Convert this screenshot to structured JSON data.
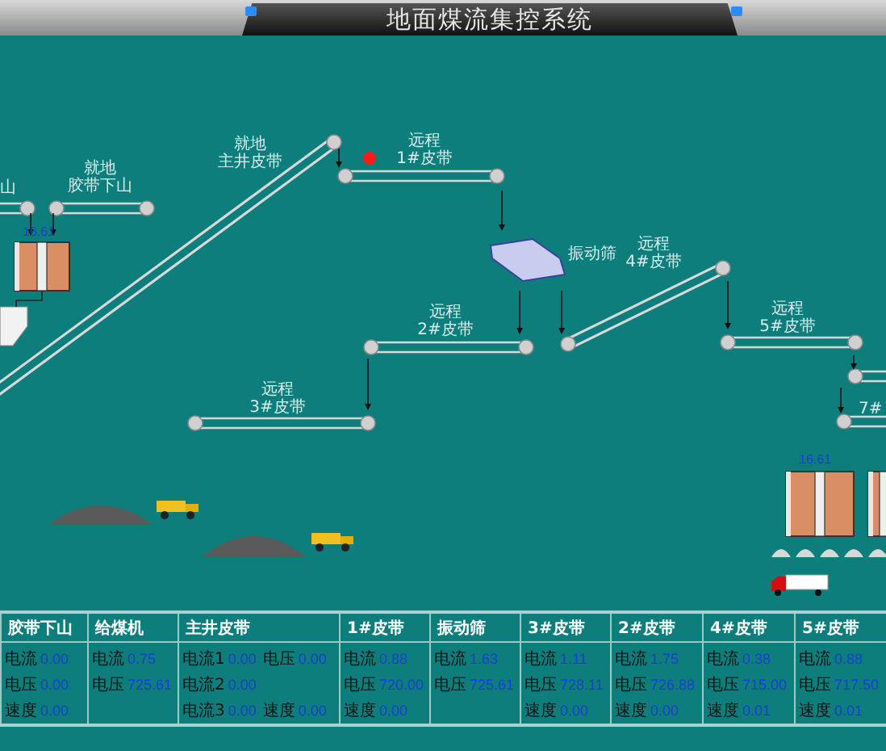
{
  "window": {
    "title": "地面煤流集控系统"
  },
  "diagram": {
    "belts": [
      {
        "kind": "flat",
        "name": "山"
      },
      {
        "kind": "flat",
        "mode": "就地",
        "name": "胶带下山"
      },
      {
        "kind": "incline",
        "mode": "就地",
        "name": "主井皮带"
      },
      {
        "kind": "flat",
        "mode": "远程",
        "name": "1#皮带"
      },
      {
        "kind": "flat",
        "mode": "远程",
        "name": "2#皮带"
      },
      {
        "kind": "flat",
        "mode": "远程",
        "name": "3#皮带"
      },
      {
        "kind": "incline",
        "mode": "远程",
        "name": "4#皮带"
      },
      {
        "kind": "flat",
        "mode": "远程",
        "name": "5#皮带"
      },
      {
        "kind": "flat"
      },
      {
        "kind": "flat",
        "name": "7#"
      }
    ],
    "screen": {
      "name": "振动筛"
    },
    "silos": [
      {
        "reading": "16.61"
      },
      {
        "reading": "16.61"
      }
    ]
  },
  "table": {
    "columns": [
      {
        "kind": "normal",
        "header": "胶带下山",
        "fields": [
          {
            "label": "电流",
            "value": "0.00"
          },
          {
            "label": "电压",
            "value": "0.00"
          },
          {
            "label": "速度",
            "value": "0.00"
          }
        ]
      },
      {
        "kind": "normal",
        "header": "给煤机",
        "fields": [
          {
            "label": "电流",
            "value": "0.75"
          },
          {
            "label": "电压",
            "value": "725.61"
          }
        ]
      },
      {
        "kind": "wide",
        "header": "主井皮带",
        "fields": [
          {
            "label": "电流1",
            "value": "0.00"
          },
          {
            "label": "电压",
            "value": "0.00"
          },
          {
            "label": "电流2",
            "value": "0.00"
          },
          {
            "label": "电流3",
            "value": "0.00"
          },
          {
            "label": "速度",
            "value": "0.00"
          }
        ]
      },
      {
        "kind": "normal",
        "header": "1#皮带",
        "fields": [
          {
            "label": "电流",
            "value": "0.88"
          },
          {
            "label": "电压",
            "value": "720.00"
          },
          {
            "label": "速度",
            "value": "0.00"
          }
        ]
      },
      {
        "kind": "normal",
        "header": "振动筛",
        "fields": [
          {
            "label": "电流",
            "value": "1.63"
          },
          {
            "label": "电压",
            "value": "725.61"
          }
        ]
      },
      {
        "kind": "normal",
        "header": "3#皮带",
        "fields": [
          {
            "label": "电流",
            "value": "1.11"
          },
          {
            "label": "电压",
            "value": "728.11"
          },
          {
            "label": "速度",
            "value": "0.00"
          }
        ]
      },
      {
        "kind": "normal",
        "header": "2#皮带",
        "fields": [
          {
            "label": "电流",
            "value": "1.75"
          },
          {
            "label": "电压",
            "value": "726.88"
          },
          {
            "label": "速度",
            "value": "0.00"
          }
        ]
      },
      {
        "kind": "normal",
        "header": "4#皮带",
        "fields": [
          {
            "label": "电流",
            "value": "0.38"
          },
          {
            "label": "电压",
            "value": "715.00"
          },
          {
            "label": "速度",
            "value": "0.01"
          }
        ]
      },
      {
        "kind": "normal",
        "header": "5#皮带",
        "fields": [
          {
            "label": "电流",
            "value": "0.88"
          },
          {
            "label": "电压",
            "value": "717.50"
          },
          {
            "label": "速度",
            "value": "0.01"
          }
        ]
      }
    ]
  }
}
